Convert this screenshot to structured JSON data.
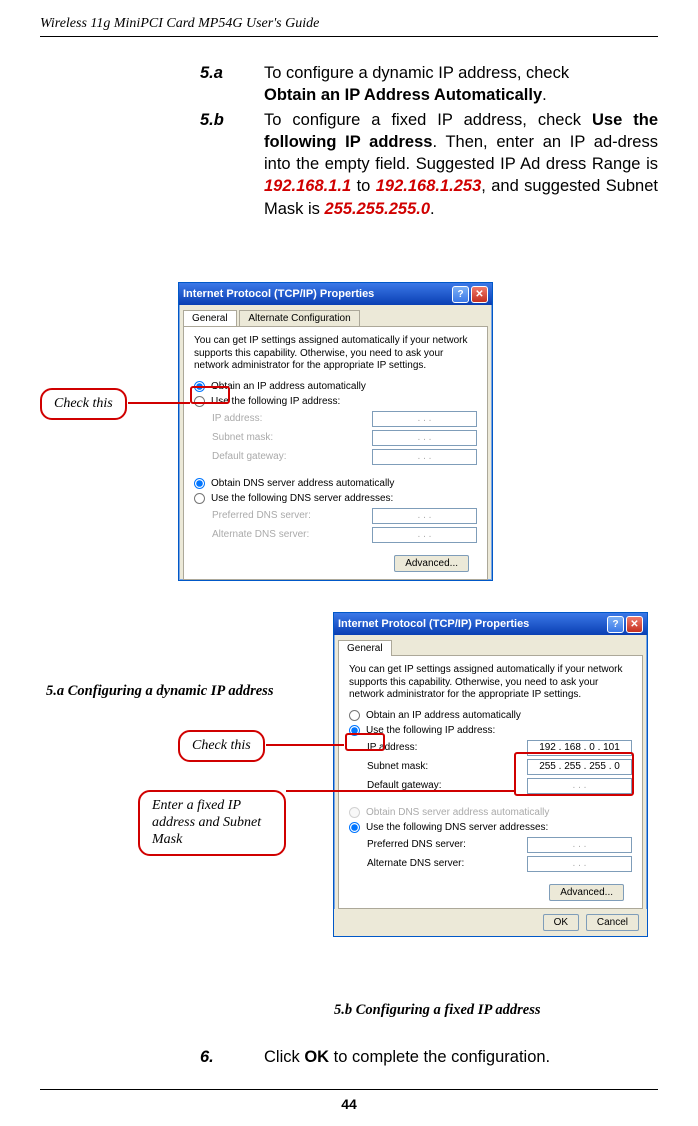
{
  "header_title": "Wireless 11g MiniPCI Card MP54G User's Guide",
  "body": {
    "item_5a_num": "5.a",
    "item_5a_text_1": "To configure a dynamic IP address, check",
    "item_5a_bold": "Obtain an IP Address Automatically",
    "item_5a_period": ".",
    "item_5b_num": "5.b",
    "item_5b_text_1": "To configure a fixed IP address, check ",
    "item_5b_bold1": "Use the following IP address",
    "item_5b_text_2": ".  Then, enter an IP ad-dress into the empty field.  Suggested IP Ad dress Range is ",
    "item_5b_red1": "192.168.1.1",
    "item_5b_text_3": " to ",
    "item_5b_red2": "192.168.1.253",
    "item_5b_text_4": ", and suggested Subnet Mask is ",
    "item_5b_red3": "255.255.255.0",
    "item_5b_period": "."
  },
  "dialog": {
    "title": "Internet Protocol (TCP/IP) Properties",
    "tab_general": "General",
    "tab_alternate": "Alternate Configuration",
    "desc": "You can get IP settings assigned automatically if your network supports this capability. Otherwise, you need to ask your network administrator for the appropriate IP settings.",
    "r_obtain_ip": "Obtain an IP address automatically",
    "r_use_ip": "Use the following IP address:",
    "lbl_ip": "IP address:",
    "lbl_subnet": "Subnet mask:",
    "lbl_gateway": "Default gateway:",
    "r_obtain_dns": "Obtain DNS server address automatically",
    "r_use_dns": "Use the following DNS server addresses:",
    "lbl_pref_dns": "Preferred DNS server:",
    "lbl_alt_dns": "Alternate DNS server:",
    "btn_advanced": "Advanced...",
    "btn_ok": "OK",
    "btn_cancel": "Cancel",
    "dots": ".       .       .",
    "ip_val": "192 . 168 .   0  . 101",
    "mask_val": "255 . 255 . 255 .   0"
  },
  "callouts": {
    "check_this": "Check this",
    "enter_ip": "Enter a fixed IP address and Subnet Mask"
  },
  "captions": {
    "c5a": "5.a Configuring a dynamic IP address",
    "c5b": "5.b Configuring a fixed IP address"
  },
  "footer": {
    "num": "6.",
    "text_1": "Click ",
    "bold": "OK",
    "text_2": " to complete the configuration."
  },
  "page_number": "44"
}
